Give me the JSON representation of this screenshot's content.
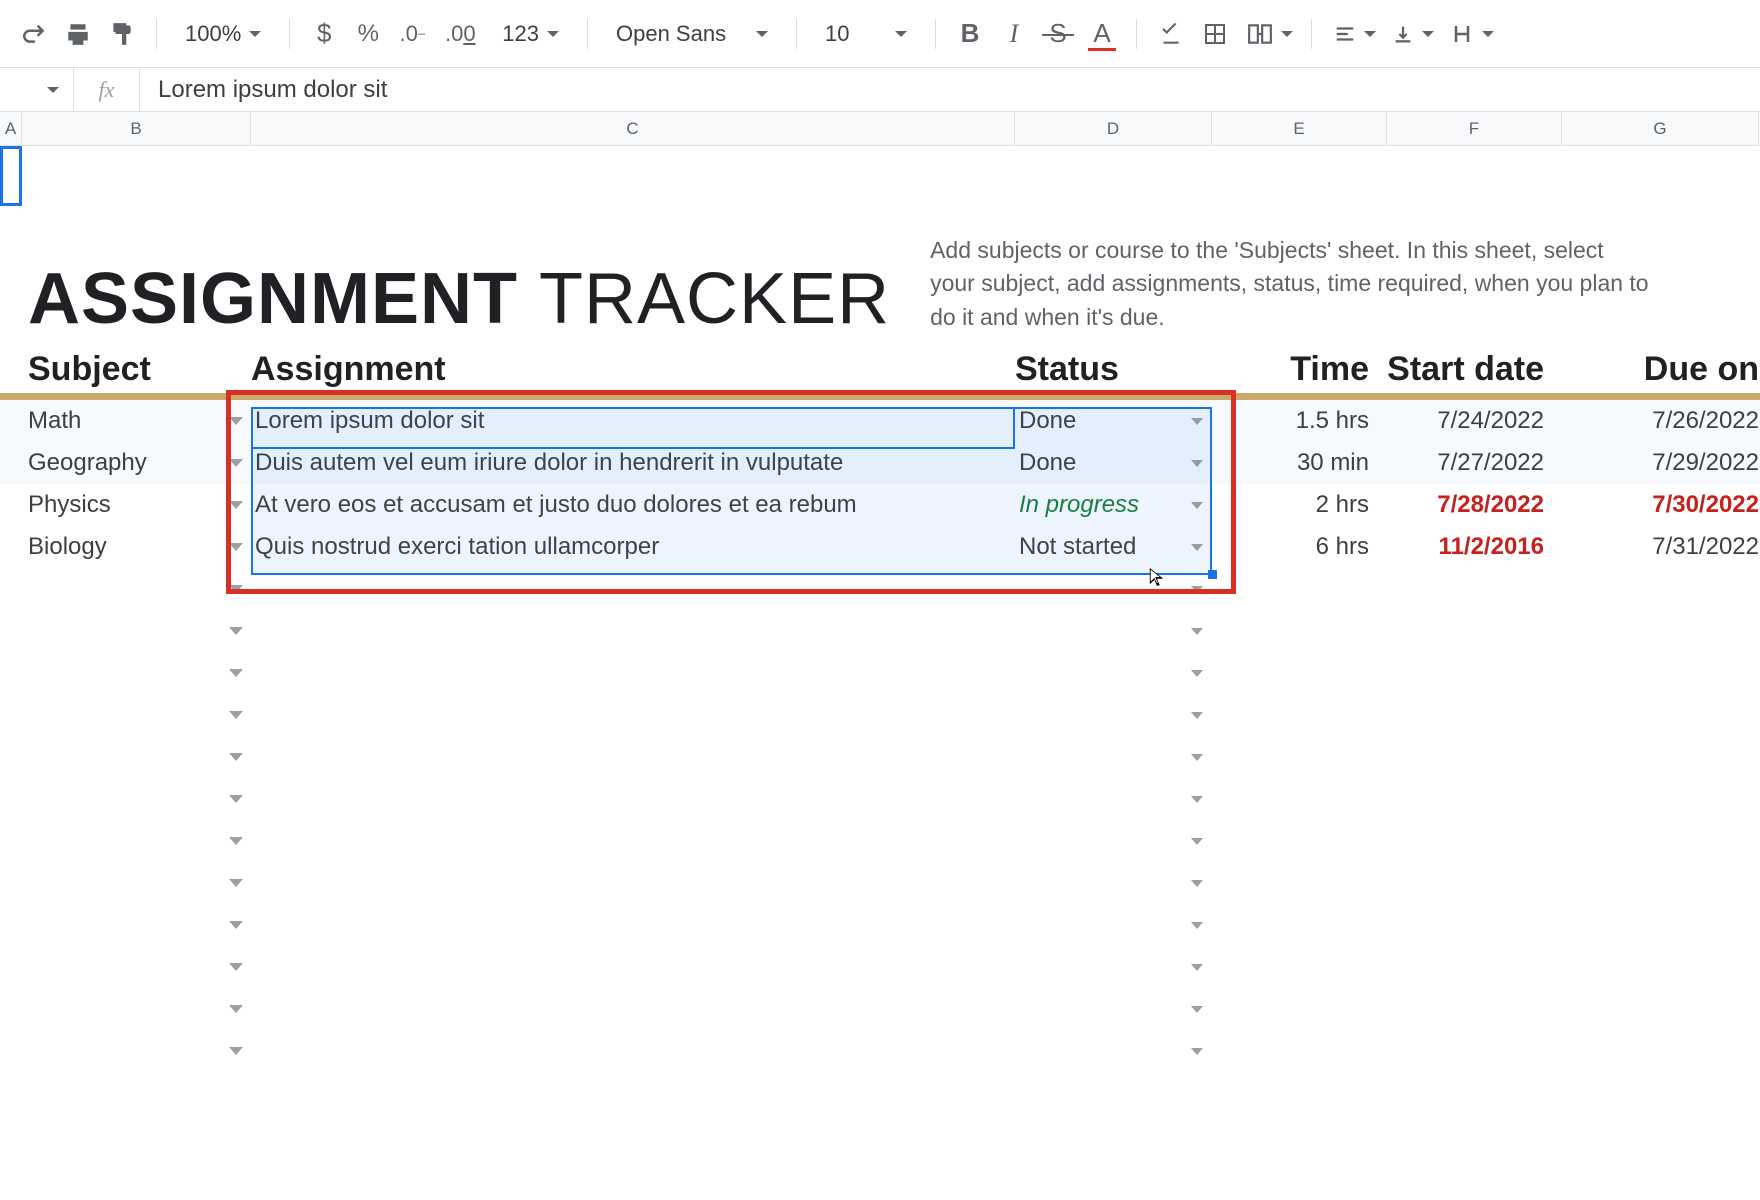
{
  "toolbar": {
    "zoom": "100%",
    "font": "Open Sans",
    "font_size": "10",
    "more_formats": "123"
  },
  "formula_bar": {
    "value": "Lorem ipsum dolor sit"
  },
  "columns": [
    "A",
    "B",
    "C",
    "D",
    "E",
    "F",
    "G"
  ],
  "title_bold": "ASSIGNMENT",
  "title_light": "TRACKER",
  "description": "Add subjects or course to the 'Subjects' sheet. In this sheet, select your subject, add assignments, status, time required, when you plan to do it and when it's due.",
  "headers": {
    "subject": "Subject",
    "assignment": "Assignment",
    "status": "Status",
    "time": "Time",
    "start": "Start date",
    "due": "Due on"
  },
  "rows": [
    {
      "subject": "Math",
      "assignment": "Lorem ipsum dolor sit",
      "status": "Done",
      "status_class": "",
      "time": "1.5 hrs",
      "start": "7/24/2022",
      "start_red": false,
      "due": "7/26/2022",
      "due_red": false
    },
    {
      "subject": "Geography",
      "assignment": "Duis autem vel eum iriure dolor in hendrerit in vulputate",
      "status": "Done",
      "status_class": "",
      "time": "30 min",
      "start": "7/27/2022",
      "start_red": false,
      "due": "7/29/2022",
      "due_red": false
    },
    {
      "subject": "Physics",
      "assignment": "At vero eos et accusam et justo duo dolores et ea rebum",
      "status": "In progress",
      "status_class": "inprog",
      "time": "2 hrs",
      "start": "7/28/2022",
      "start_red": true,
      "due": "7/30/2022",
      "due_red": true
    },
    {
      "subject": "Biology",
      "assignment": "Quis nostrud exerci tation ullamcorper",
      "status": "Not started",
      "status_class": "",
      "time": "6 hrs",
      "start": "11/2/2016",
      "start_red": true,
      "due": "7/31/2022",
      "due_red": false
    }
  ],
  "empty_rows": 12
}
